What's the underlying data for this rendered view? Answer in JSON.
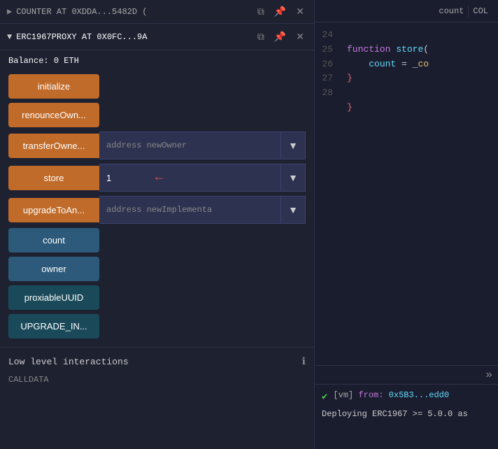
{
  "left": {
    "counter_bar": {
      "label": "COUNTER AT 0XDDA...5482D (",
      "copy_title": "Copy",
      "pin_title": "Pin",
      "close_title": "Close"
    },
    "proxy_bar": {
      "label": "ERC1967PROXY AT 0X0FC...9A",
      "copy_title": "Copy",
      "pin_title": "Pin",
      "close_title": "Close"
    },
    "balance": {
      "label": "Balance:",
      "value": "0 ETH"
    },
    "buttons": {
      "initialize": "initialize",
      "renounceOwn": "renounceOwn...",
      "transferOwne": "transferOwne...",
      "address_newOwner_placeholder": "address newOwner",
      "store": "store",
      "store_value": "1",
      "upgradeToAn": "upgradeToAn...",
      "address_newImplementa_placeholder": "address newImplementa",
      "count": "count",
      "owner": "owner",
      "proxiableUUID": "proxiableUUID",
      "UPGRADE_IN": "UPGRADE_IN..."
    },
    "low_level": {
      "title": "Low level interactions",
      "info": "ℹ",
      "calldata": "CALLDATA"
    }
  },
  "right": {
    "topbar": {
      "count_label": "count",
      "col_label": "COL"
    },
    "lines": [
      {
        "num": "24",
        "code": "function store("
      },
      {
        "num": "25",
        "code": "    count = _co"
      },
      {
        "num": "26",
        "code": "}"
      },
      {
        "num": "27",
        "code": ""
      },
      {
        "num": "28",
        "code": "}"
      }
    ],
    "console": {
      "chevrons": "»",
      "log_prefix": "[vm]",
      "from_label": "from:",
      "from_value": "0x5B3...edd0",
      "deploy_text": "Deploying ERC1967 >= 5.0.0 as"
    }
  }
}
